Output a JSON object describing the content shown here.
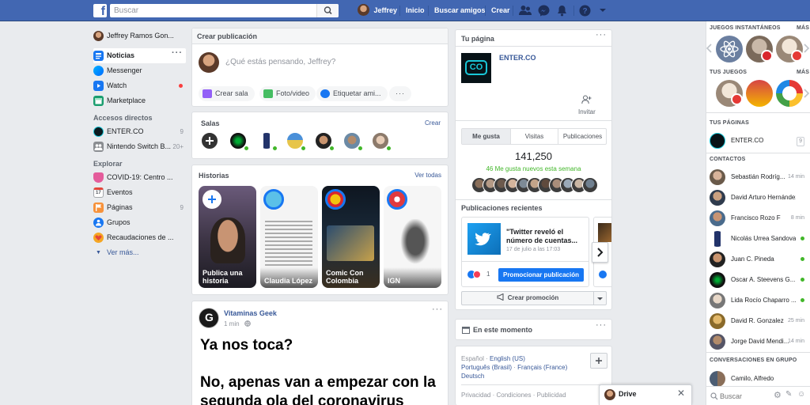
{
  "topbar": {
    "search_placeholder": "Buscar",
    "user_name": "Jeffrey",
    "nav_home": "Inicio",
    "nav_find_friends": "Buscar amigos",
    "nav_create": "Crear"
  },
  "left_nav": {
    "profile_name": "Jeffrey Ramos Gon...",
    "main_items": [
      {
        "label": "Noticias"
      },
      {
        "label": "Messenger"
      },
      {
        "label": "Watch"
      },
      {
        "label": "Marketplace"
      }
    ],
    "shortcuts_heading": "Accesos directos",
    "shortcuts": [
      {
        "label": "ENTER.CO",
        "count": "9"
      },
      {
        "label": "Nintendo Switch B...",
        "count": "20+"
      }
    ],
    "explore_heading": "Explorar",
    "explore": [
      {
        "label": "COVID-19: Centro ..."
      },
      {
        "label": "Eventos"
      },
      {
        "label": "Páginas",
        "count": "9"
      },
      {
        "label": "Grupos"
      },
      {
        "label": "Recaudaciones de ..."
      }
    ],
    "see_more": "Ver más..."
  },
  "composer": {
    "title": "Crear publicación",
    "placeholder": "¿Qué estás pensando, Jeffrey?",
    "btn_room": "Crear sala",
    "btn_photo": "Foto/video",
    "btn_tag": "Etiquetar ami..."
  },
  "rooms": {
    "title": "Salas",
    "create": "Crear"
  },
  "stories": {
    "title": "Historias",
    "see_all": "Ver todas",
    "items": [
      {
        "label": "Publica una historia"
      },
      {
        "label": "Claudia López"
      },
      {
        "label": "Comic Con Colombia"
      },
      {
        "label": "IGN"
      }
    ]
  },
  "post": {
    "page_name": "Vitaminas Geek",
    "time": "1 min",
    "line1": "Ya nos toca?",
    "line2": "No, apenas van a empezar con la",
    "line3": "segunda ola del coronavirus"
  },
  "page_card": {
    "title": "Tu página",
    "page_name": "ENTER.CO",
    "logo_text": "CO",
    "invite": "Invitar",
    "tabs": [
      "Me gusta",
      "Visitas",
      "Publicaciones"
    ],
    "likes": "141,250",
    "likes_new": "46 Me gusta nuevos esta semana",
    "recent_title": "Publicaciones recientes",
    "recent_post_title": "\"Twitter reveló el número de cuentas...",
    "recent_post_date": "17 de julio a las 17:03",
    "reactions_count": "1",
    "promote_post": "Promocionar publicación",
    "create_promo": "Crear promoción"
  },
  "now_card": {
    "title": "En este momento"
  },
  "languages": {
    "items": [
      "Español",
      "English (US)",
      "Português (Brasil)",
      "Français (France)",
      "Deutsch"
    ],
    "footer_links": [
      "Privacidad",
      "Condiciones",
      "Publicidad"
    ]
  },
  "drive": {
    "label": "Drive"
  },
  "sidebar": {
    "games_heading": "JUEGOS INSTANTÁNEOS",
    "games_more": "MÁS",
    "your_games_heading": "TUS JUEGOS",
    "your_games_more": "MÁS",
    "pages_heading": "TUS PÁGINAS",
    "page_item": {
      "name": "ENTER.CO",
      "count": "9"
    },
    "contacts_heading": "CONTACTOS",
    "contacts": [
      {
        "name": "Sebastián Rodríg...",
        "meta": "14 min"
      },
      {
        "name": "David Arturo Hernández",
        "meta": ""
      },
      {
        "name": "Francisco Rozo F",
        "meta": "8 min"
      },
      {
        "name": "Nicolás Urrea Sandoval",
        "meta": ""
      },
      {
        "name": "Juan C. Pineda",
        "meta": ""
      },
      {
        "name": "Oscar A. Steevens G...",
        "meta": ""
      },
      {
        "name": "Lida Rocío Chaparro ...",
        "meta": ""
      },
      {
        "name": "David R. Gonzalez",
        "meta": "25 min"
      },
      {
        "name": "Jorge David Mendi...",
        "meta": "14 min"
      }
    ],
    "groups_heading": "CONVERSACIONES EN GRUPO",
    "group_item": "Camilo, Alfredo",
    "search_placeholder": "Buscar"
  },
  "colors": {
    "brand_blue": "#4267b2",
    "online_green": "#42b72a",
    "link_blue": "#385898",
    "promote_blue": "#1877f2"
  }
}
